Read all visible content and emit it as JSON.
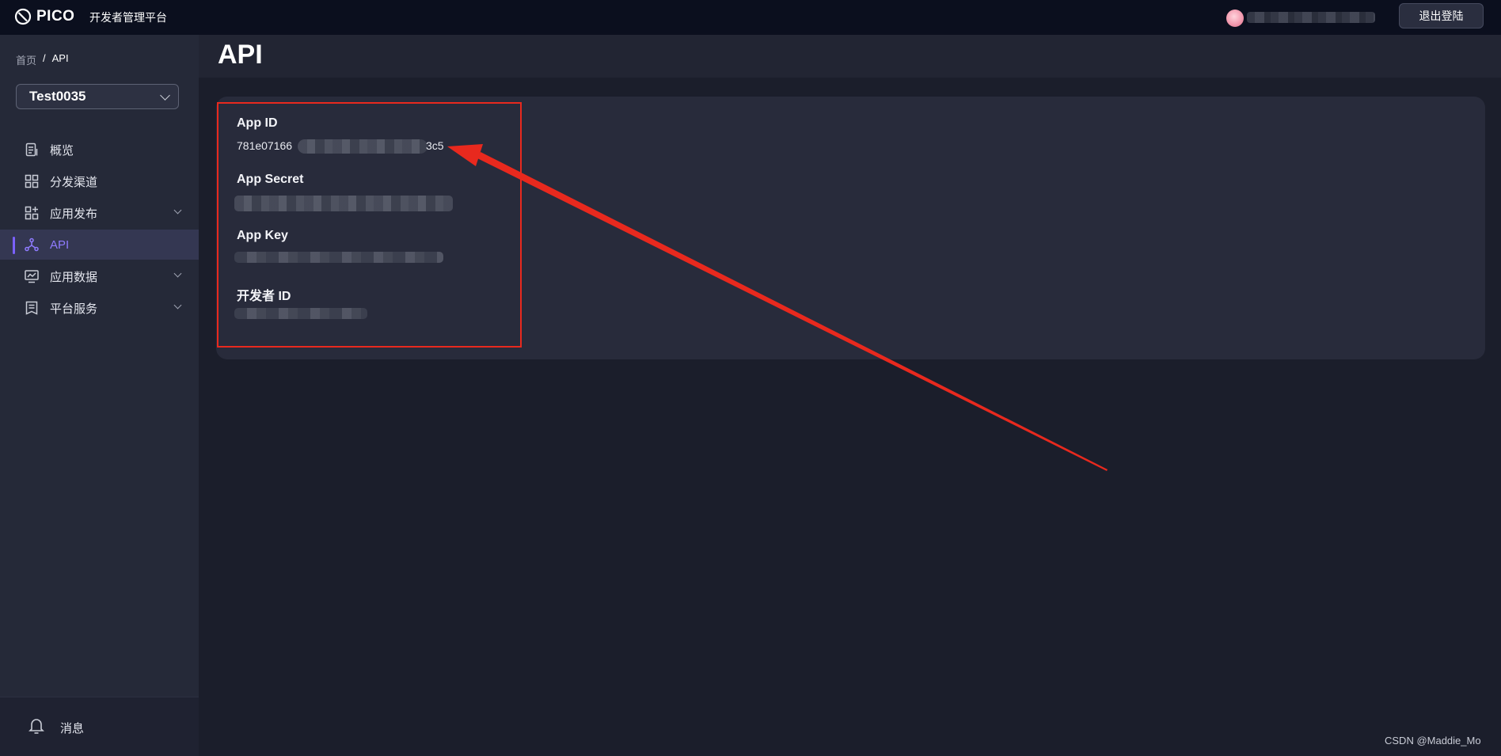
{
  "brand": {
    "logo_text": "PICO",
    "platform_name": "开发者管理平台"
  },
  "header": {
    "logout_label": "退出登陆"
  },
  "breadcrumb": {
    "home": "首页",
    "separator": "/",
    "current": "API"
  },
  "app_selector": {
    "value": "Test0035"
  },
  "sidebar": {
    "items": [
      {
        "label": "概览",
        "icon": "overview-doc-icon",
        "expandable": false,
        "active": false
      },
      {
        "label": "分发渠道",
        "icon": "grid-icon",
        "expandable": false,
        "active": false
      },
      {
        "label": "应用发布",
        "icon": "app-grid-plus-icon",
        "expandable": true,
        "active": false
      },
      {
        "label": "API",
        "icon": "api-nodes-icon",
        "expandable": false,
        "active": true
      },
      {
        "label": "应用数据",
        "icon": "chart-monitor-icon",
        "expandable": true,
        "active": false
      },
      {
        "label": "平台服务",
        "icon": "service-doc-icon",
        "expandable": true,
        "active": false
      }
    ],
    "footer": {
      "label": "消息",
      "icon": "bell-icon"
    }
  },
  "page": {
    "title": "API"
  },
  "credentials": {
    "app_id": {
      "label": "App ID",
      "value_start": "781e07166",
      "value_end": "3c5"
    },
    "app_secret": {
      "label": "App Secret"
    },
    "app_key": {
      "label": "App Key"
    },
    "developer_id": {
      "label": "开发者 ID"
    }
  },
  "annotation": {
    "color": "#e8291e"
  },
  "colors": {
    "accent": "#7b61ff",
    "background": "#1b1e2b",
    "topbar": "#0b0f1e",
    "sidebar": "#252938"
  },
  "watermark": "CSDN @Maddie_Mo"
}
